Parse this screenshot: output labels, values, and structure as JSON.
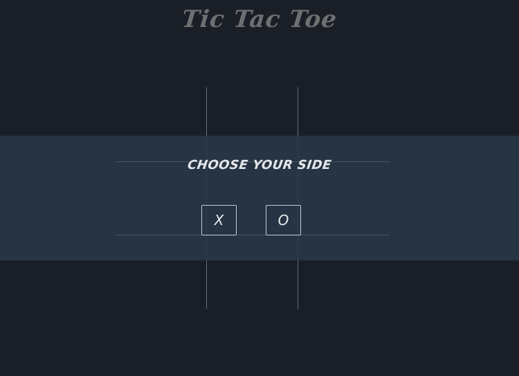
{
  "header": {
    "title": "Tic Tac Toe"
  },
  "modal": {
    "prompt": "CHOOSE YOUR SIDE",
    "options": [
      {
        "label": "X"
      },
      {
        "label": "O"
      }
    ]
  },
  "colors": {
    "background": "#1a1f27",
    "overlay": "#283848",
    "title": "#6e6f71",
    "text": "#e3e6ea",
    "grid": "#6a7078"
  }
}
